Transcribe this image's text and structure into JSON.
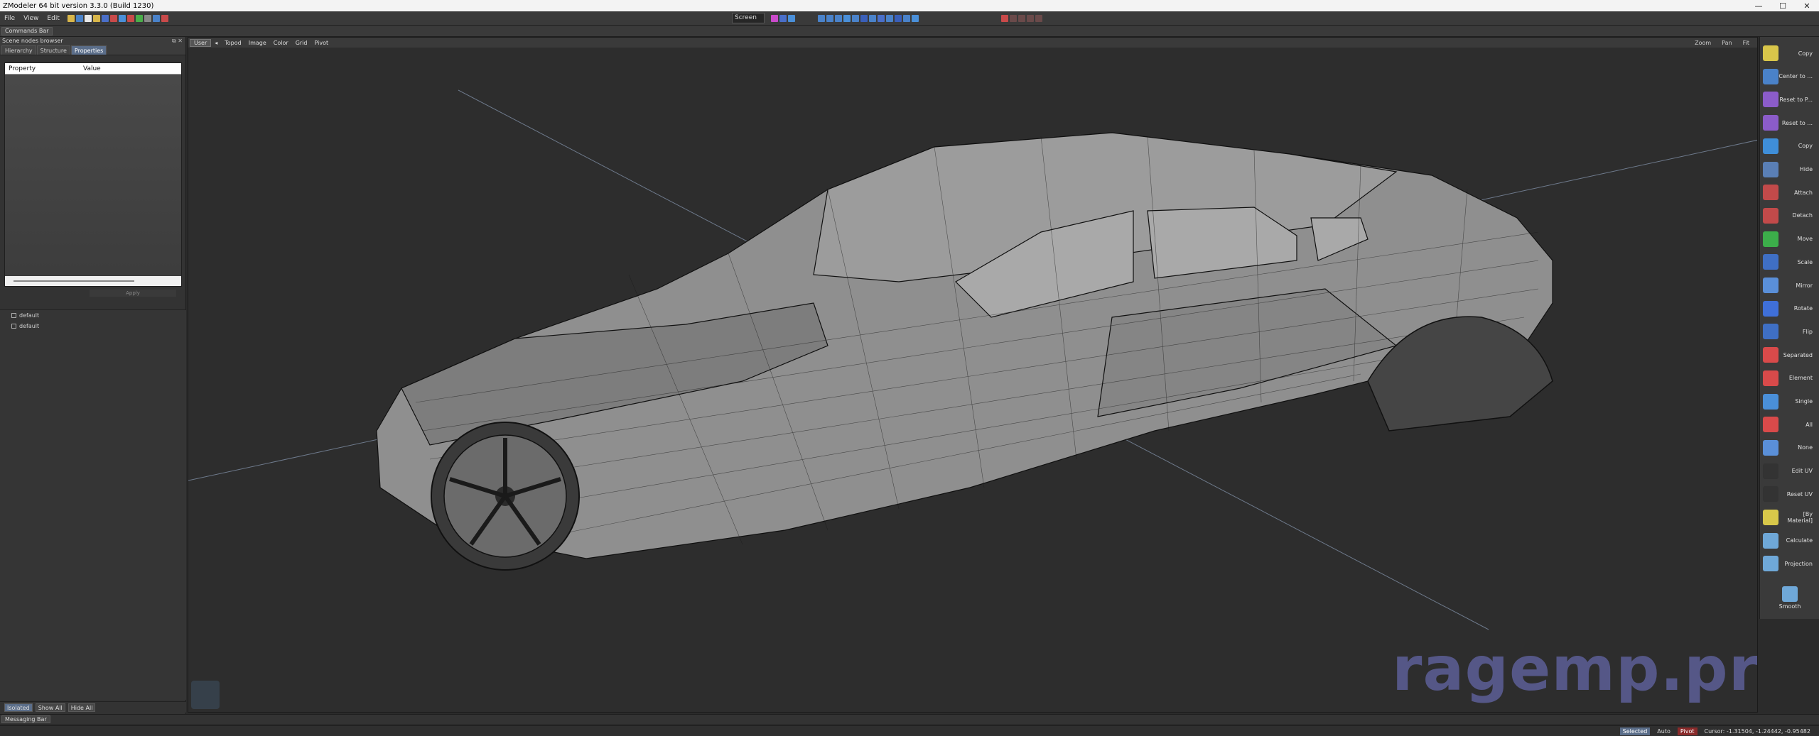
{
  "window": {
    "title": "ZModeler 64 bit version 3.3.0 (Build 1230)",
    "minimize_icon": "—",
    "maximize_icon": "☐",
    "close_icon": "✕"
  },
  "menu": {
    "items": [
      "File",
      "View",
      "Edit"
    ]
  },
  "toolbar": {
    "screen_select": "Screen"
  },
  "commands_bar": "Commands Bar",
  "scene_browser": {
    "title": "Scene nodes browser",
    "buttons": "⧉ ✕",
    "tabs": [
      "Hierarchy",
      "Structure",
      "Properties"
    ],
    "properties_header": {
      "col1": "Property",
      "col2": "Value"
    },
    "footer_button": "Apply"
  },
  "tree": {
    "items": [
      "default",
      "default"
    ]
  },
  "left_bottom": {
    "isolated": "Isolated",
    "show_all": "Show All",
    "hide_all": "Hide All"
  },
  "viewport": {
    "menu": [
      "User",
      "◂",
      "Topod",
      "Image",
      "Color",
      "Grid",
      "Pivot"
    ],
    "right_controls": [
      "Zoom",
      "Pan",
      "Fit"
    ]
  },
  "watermark": "ragemp.pro",
  "right_toolbar": {
    "items": [
      {
        "label": "Copy",
        "icon": "copy-icon",
        "color": "#d9c64a"
      },
      {
        "label": "Center to ...",
        "icon": "center-icon",
        "color": "#4a82c9"
      },
      {
        "label": "Reset to P...",
        "icon": "reset-pivot-icon",
        "color": "#8b5cc9"
      },
      {
        "label": "Reset to ...",
        "icon": "reset-icon",
        "color": "#8b5cc9"
      },
      {
        "label": "Copy",
        "icon": "copy-icon",
        "color": "#3f8ed8"
      },
      {
        "label": "Hide",
        "icon": "hide-icon",
        "color": "#5a7fb5"
      },
      {
        "label": "Attach",
        "icon": "attach-icon",
        "color": "#c24a4a"
      },
      {
        "label": "Detach",
        "icon": "detach-icon",
        "color": "#c24a4a"
      },
      {
        "label": "Move",
        "icon": "move-icon",
        "color": "#3cae4a"
      },
      {
        "label": "Scale",
        "icon": "scale-icon",
        "color": "#3f6fc4"
      },
      {
        "label": "Mirror",
        "icon": "mirror-icon",
        "color": "#5a8fd8"
      },
      {
        "label": "Rotate",
        "icon": "rotate-icon",
        "color": "#3f6fd8"
      },
      {
        "label": "Flip",
        "icon": "flip-icon",
        "color": "#3f6fc4"
      },
      {
        "label": "Separated",
        "icon": "separated-icon",
        "color": "#d84a4a"
      },
      {
        "label": "Element",
        "icon": "element-icon",
        "color": "#d84a4a"
      },
      {
        "label": "Single",
        "icon": "single-icon",
        "color": "#4a8fd8"
      },
      {
        "label": "All",
        "icon": "all-icon",
        "color": "#d84a4a"
      },
      {
        "label": "None",
        "icon": "none-icon",
        "color": "#5a8fd8"
      },
      {
        "label": "Edit UV",
        "icon": "edit-uv-icon",
        "color": "#333333"
      },
      {
        "label": "Reset UV",
        "icon": "reset-uv-icon",
        "color": "#333333"
      },
      {
        "label": "[By Material]",
        "icon": "material-icon",
        "color": "#d8c84a"
      },
      {
        "label": "Calculate",
        "icon": "calculate-icon",
        "color": "#6fa8d8"
      },
      {
        "label": "Projection",
        "icon": "projection-icon",
        "color": "#6fa8d8"
      }
    ],
    "smooth": "Smooth"
  },
  "messaging_bar": "Messaging Bar",
  "status": {
    "selected": "Selected",
    "auto": "Auto",
    "pivot": "Pivot",
    "cursor": "Cursor: -1.31504, -1.24442, -0.95482"
  }
}
